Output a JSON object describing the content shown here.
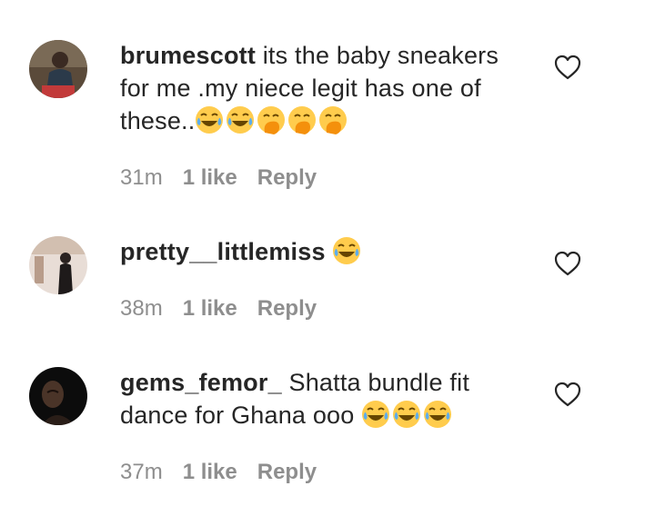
{
  "comments": [
    {
      "username": "brumescott",
      "text": " its the baby sneakers for me .my niece legit has one of these..",
      "emojis": [
        "laugh-cry",
        "laugh-cry",
        "hand-over-mouth",
        "hand-over-mouth",
        "hand-over-mouth"
      ],
      "time": "31m",
      "likes": "1 like",
      "reply": "Reply"
    },
    {
      "username": "pretty__littlemiss",
      "text": " ",
      "emojis": [
        "laugh-cry"
      ],
      "time": "38m",
      "likes": "1 like",
      "reply": "Reply"
    },
    {
      "username": "gems_femor_",
      "text": " Shatta bundle fit dance for Ghana ooo ",
      "emojis": [
        "laugh-cry",
        "laugh-cry",
        "laugh-cry"
      ],
      "time": "37m",
      "likes": "1 like",
      "reply": "Reply"
    }
  ],
  "colors": {
    "text": "#262626",
    "meta": "#8e8e8e",
    "emoji": "#ffcc4d"
  }
}
